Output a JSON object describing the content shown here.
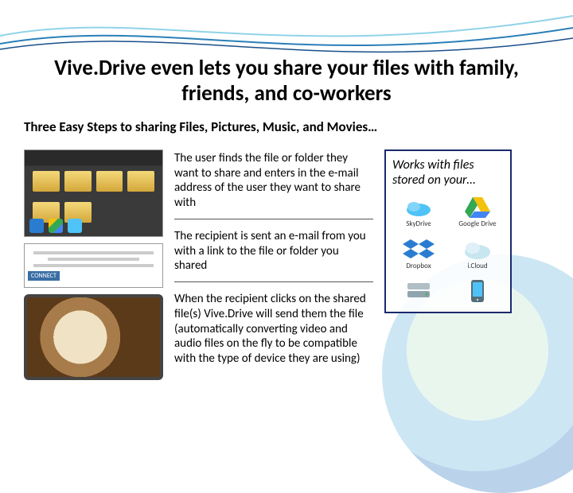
{
  "title": "Vive.Drive even lets you share your files with family, friends, and co-workers",
  "subtitle": "Three Easy Steps to sharing Files, Pictures, Music, and Movies…",
  "steps": [
    "The user finds the file or folder they want to share and enters in the e-mail address of the user they want to share with",
    "The recipient is sent an e-mail from you with a link to the file or folder you shared",
    "When the recipient clicks on the shared file(s) Vive.Drive will send them the file (automatically converting video and audio files on the fly to be compatible with the type of device they are using)"
  ],
  "sidebar": {
    "title": "Works with files stored on your…",
    "services": [
      {
        "name": "SkyDrive"
      },
      {
        "name": "Google Drive"
      },
      {
        "name": "Dropbox"
      },
      {
        "name": "i.Cloud"
      },
      {
        "name": "Hard Drive"
      },
      {
        "name": "Device"
      }
    ]
  },
  "thumb2_badge": "CONNECT"
}
